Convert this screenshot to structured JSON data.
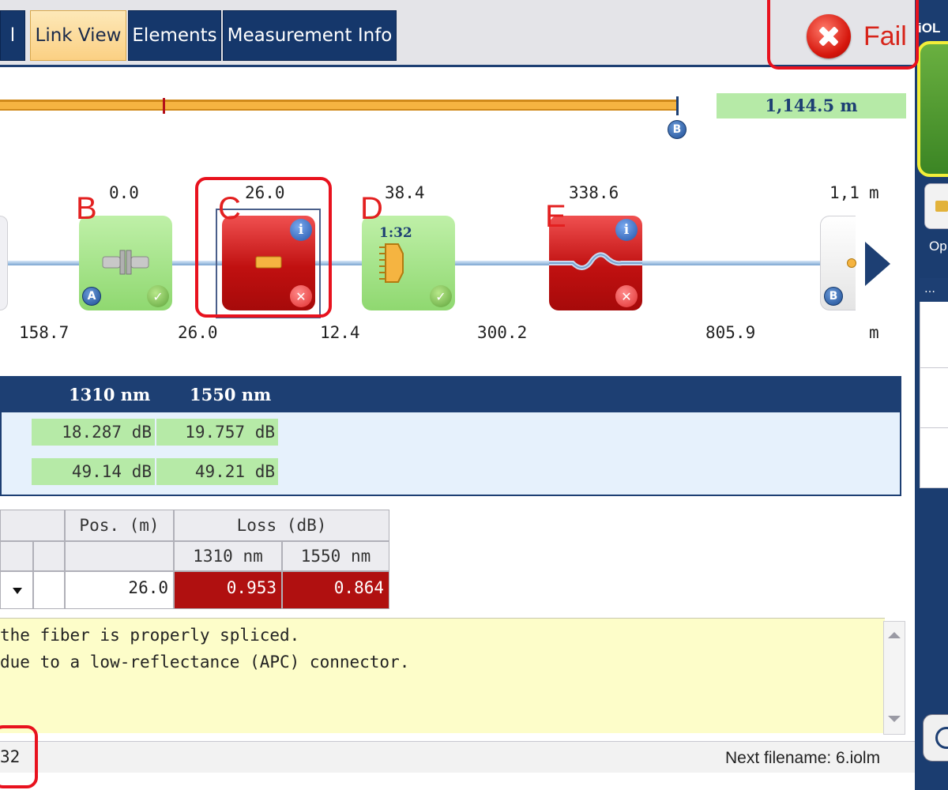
{
  "tabs": [
    {
      "label": "l"
    },
    {
      "label": "Link View"
    },
    {
      "label": "Elements"
    },
    {
      "label": "Measurement Info"
    }
  ],
  "status_verdict": "Fail",
  "side_panel": {
    "title": "iOL",
    "open_label": "Op",
    "list_header": "…"
  },
  "link": {
    "total_length": "1,144.5 m",
    "end_marker": "B",
    "start_marker": "A",
    "unit": "m",
    "positions": [
      "0.0",
      "26.0",
      "38.4",
      "338.6",
      "1,1"
    ],
    "segments": [
      "158.7",
      "26.0",
      "12.4",
      "300.2",
      "805.9"
    ],
    "splitter_ratio": "1:32",
    "elements": [
      {
        "letter": "B",
        "status": "pass"
      },
      {
        "letter": "C",
        "status": "fail"
      },
      {
        "letter": "D",
        "status": "pass"
      },
      {
        "letter": "E",
        "status": "fail"
      }
    ]
  },
  "summary": {
    "columns": [
      "1310 nm",
      "1550 nm"
    ],
    "rows": [
      [
        "18.287 dB",
        "19.757 dB"
      ],
      [
        "49.14 dB",
        "49.21 dB"
      ]
    ]
  },
  "event_table": {
    "pos_header": "Pos. (m)",
    "loss_header": "Loss (dB)",
    "loss_columns": [
      "1310 nm",
      "1550 nm"
    ],
    "row": {
      "pos": "26.0",
      "loss": [
        "0.953",
        "0.864"
      ]
    }
  },
  "notes": [
    "the fiber is properly spliced.",
    " due to a low-reflectance (APC) connector."
  ],
  "status_bar": {
    "left": "32",
    "right": "Next filename: 6.iolm"
  },
  "colors": {
    "navy": "#1d3f73",
    "fail_red": "#b01010",
    "pass_green": "#b6eaa7",
    "annotation_red": "#e8121e",
    "highlight_yellow": "#f2ee3a"
  }
}
